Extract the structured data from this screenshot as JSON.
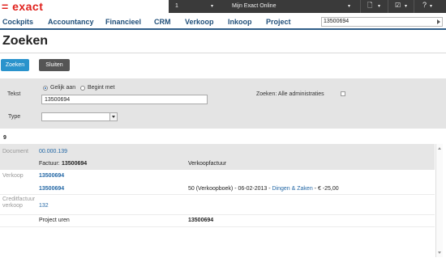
{
  "app": {
    "logo": "= exact"
  },
  "topbar": {
    "division": "1",
    "title": "Mijn Exact Online",
    "help": "?"
  },
  "nav": {
    "items": [
      "Cockpits",
      "Accountancy",
      "Financieel",
      "CRM",
      "Verkoop",
      "Inkoop",
      "Project"
    ],
    "search_value": "13500694"
  },
  "page": {
    "title": "Zoeken"
  },
  "actions": {
    "search": "Zoeken",
    "close": "Sluiten"
  },
  "form": {
    "text_label": "Tekst",
    "option_equal": "Gelijk aan",
    "option_starts": "Begint met",
    "text_value": "13500694",
    "all_admin_label": "Zoeken: Alle administraties",
    "type_label": "Type",
    "type_value": ""
  },
  "results": {
    "count": "9",
    "rows": {
      "document_category": "Document",
      "document_link": "00.000.139",
      "factuur_label": "Factuur:",
      "factuur_number": "13500694",
      "factuur_type": "Verkoopfactuur",
      "verkoop_category": "Verkoop",
      "verkoop_link": "13500694",
      "verkoop_sub_link": "13500694",
      "verkoop_detail_pre": "50 (Verkoopboek) - 06-02-2013 -",
      "verkoop_detail_link": "Dingen & Zaken",
      "verkoop_detail_post": "- € -25,00",
      "credit_category": "Creditfactuur verkoop",
      "credit_link": "132",
      "project_label": "Project uren",
      "project_number": "13500694"
    }
  }
}
